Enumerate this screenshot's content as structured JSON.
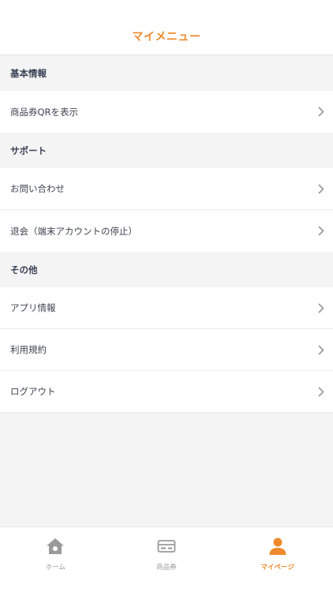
{
  "header": {
    "title": "マイメニュー"
  },
  "sections": [
    {
      "title": "基本情報",
      "items": [
        {
          "label": "商品券QRを表示"
        }
      ]
    },
    {
      "title": "サポート",
      "items": [
        {
          "label": "お問い合わせ"
        },
        {
          "label": "退会（端末アカウントの停止）"
        }
      ]
    },
    {
      "title": "その他",
      "items": [
        {
          "label": "アプリ情報"
        },
        {
          "label": "利用規約"
        },
        {
          "label": "ログアウト"
        }
      ]
    }
  ],
  "tabbar": {
    "tabs": [
      {
        "label": "ホーム",
        "icon": "home-icon"
      },
      {
        "label": "商品券",
        "icon": "voucher-card-icon"
      },
      {
        "label": "マイページ",
        "icon": "person-icon"
      }
    ],
    "active_color": "#ee8a2c",
    "inactive_color": "#9a9a9a"
  }
}
